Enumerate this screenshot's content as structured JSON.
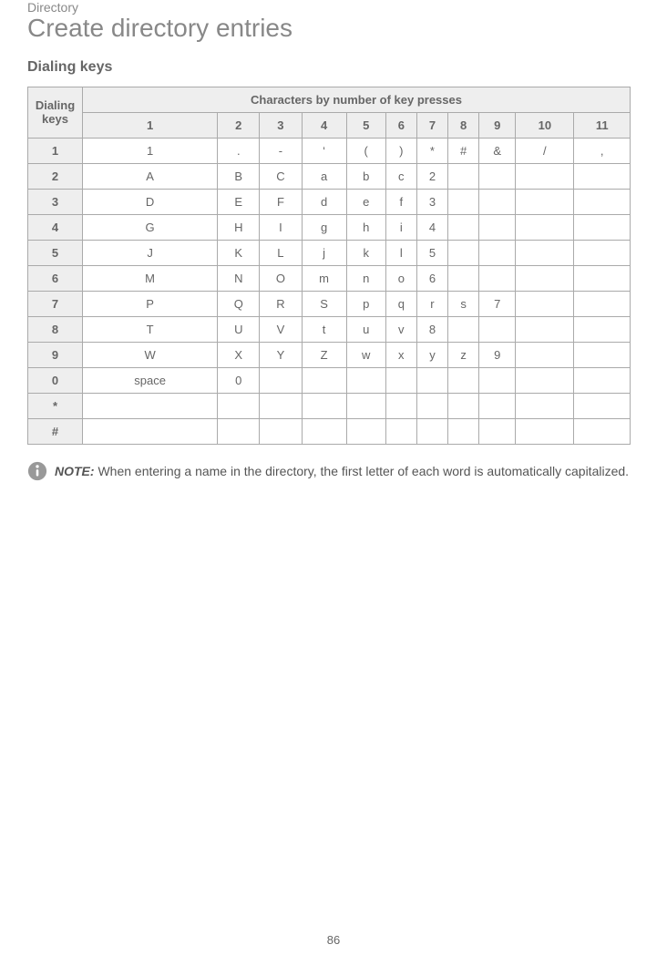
{
  "header": {
    "breadcrumb": "Directory",
    "title": "Create directory entries",
    "section": "Dialing keys"
  },
  "table": {
    "corner": "Dialing keys",
    "superheader": "Characters by number of key presses",
    "columns": [
      "1",
      "2",
      "3",
      "4",
      "5",
      "6",
      "7",
      "8",
      "9",
      "10",
      "11"
    ],
    "rows": [
      {
        "key": "1",
        "cells": [
          "1",
          ".",
          "-",
          "‘",
          "(",
          ")",
          "*",
          "#",
          "&",
          "/",
          ","
        ]
      },
      {
        "key": "2",
        "cells": [
          "A",
          "B",
          "C",
          "a",
          "b",
          "c",
          "2",
          "",
          "",
          "",
          ""
        ]
      },
      {
        "key": "3",
        "cells": [
          "D",
          "E",
          "F",
          "d",
          "e",
          "f",
          "3",
          "",
          "",
          "",
          ""
        ]
      },
      {
        "key": "4",
        "cells": [
          "G",
          "H",
          "I",
          "g",
          "h",
          "i",
          "4",
          "",
          "",
          "",
          ""
        ]
      },
      {
        "key": "5",
        "cells": [
          "J",
          "K",
          "L",
          "j",
          "k",
          "l",
          "5",
          "",
          "",
          "",
          ""
        ]
      },
      {
        "key": "6",
        "cells": [
          "M",
          "N",
          "O",
          "m",
          "n",
          "o",
          "6",
          "",
          "",
          "",
          ""
        ]
      },
      {
        "key": "7",
        "cells": [
          "P",
          "Q",
          "R",
          "S",
          "p",
          "q",
          "r",
          "s",
          "7",
          "",
          ""
        ]
      },
      {
        "key": "8",
        "cells": [
          "T",
          "U",
          "V",
          "t",
          "u",
          "v",
          "8",
          "",
          "",
          "",
          ""
        ]
      },
      {
        "key": "9",
        "cells": [
          "W",
          "X",
          "Y",
          "Z",
          "w",
          "x",
          "y",
          "z",
          "9",
          "",
          ""
        ]
      },
      {
        "key": "0",
        "cells": [
          "space",
          "0",
          "",
          "",
          "",
          "",
          "",
          "",
          "",
          "",
          ""
        ]
      },
      {
        "key": "*",
        "cells": [
          "",
          "",
          "",
          "",
          "",
          "",
          "",
          "",
          "",
          "",
          ""
        ]
      },
      {
        "key": "#",
        "cells": [
          "",
          "",
          "",
          "",
          "",
          "",
          "",
          "",
          "",
          "",
          ""
        ]
      }
    ]
  },
  "note": {
    "label": "NOTE:",
    "text": " When entering a name in the directory, the first letter of each word is automatically capitalized."
  },
  "page_number": "86"
}
